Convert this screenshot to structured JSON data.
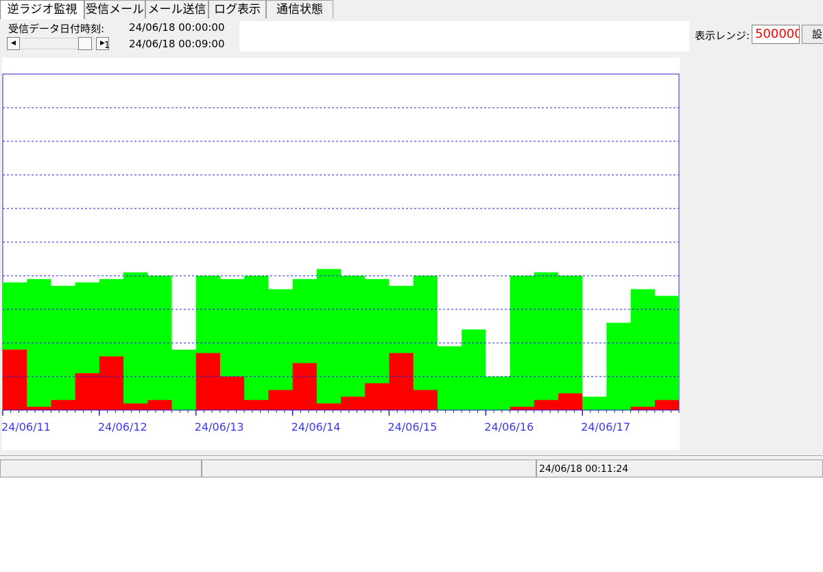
{
  "tabs": [
    {
      "label": "逆ラジオ監視",
      "active": true
    },
    {
      "label": "受信メール",
      "active": false
    },
    {
      "label": "メール送信",
      "active": false
    },
    {
      "label": "ログ表示",
      "active": false
    },
    {
      "label": "通信状態",
      "active": false
    }
  ],
  "info": {
    "received_label": "受信データ日付時刻:",
    "received_time_1": "24/06/18 00:00:00",
    "received_time_2": "24/06/18 00:09:00",
    "scroll_value": "1"
  },
  "range": {
    "label": "表示レンジ:",
    "value": "500000",
    "set_button": "設定"
  },
  "status": {
    "cell1": "",
    "cell2": "",
    "timestamp": "24/06/18 00:11:24"
  },
  "colors": {
    "series_total": "#00ff00",
    "series_sub": "#ff0000",
    "grid": "#2020c0",
    "axis_label": "#3a3af0",
    "range_value": "#ff0000"
  },
  "chart_data": {
    "type": "area",
    "x_ticks": [
      "24/06/11",
      "24/06/12",
      "24/06/13",
      "24/06/14",
      "24/06/15",
      "24/06/16",
      "24/06/17"
    ],
    "ylim": [
      0,
      500000
    ],
    "grid": true,
    "legend": "none",
    "series": [
      {
        "color": "green",
        "x": [
          "24/06/11 00:00",
          "24/06/11 06:00",
          "24/06/11 12:00",
          "24/06/11 18:00",
          "24/06/12 00:00",
          "24/06/12 06:00",
          "24/06/12 12:00",
          "24/06/12 18:00",
          "24/06/13 00:00",
          "24/06/13 06:00",
          "24/06/13 12:00",
          "24/06/13 18:00",
          "24/06/14 00:00",
          "24/06/14 06:00",
          "24/06/14 12:00",
          "24/06/14 18:00",
          "24/06/15 00:00",
          "24/06/15 06:00",
          "24/06/15 12:00",
          "24/06/15 18:00",
          "24/06/16 00:00",
          "24/06/16 06:00",
          "24/06/16 12:00",
          "24/06/16 18:00",
          "24/06/17 00:00",
          "24/06/17 06:00",
          "24/06/17 12:00",
          "24/06/17 18:00"
        ],
        "values": [
          190000,
          195000,
          185000,
          190000,
          195000,
          205000,
          200000,
          90000,
          200000,
          195000,
          200000,
          180000,
          195000,
          210000,
          200000,
          195000,
          185000,
          200000,
          95000,
          120000,
          50000,
          200000,
          205000,
          200000,
          20000,
          130000,
          180000,
          170000
        ]
      },
      {
        "color": "red",
        "x": [
          "24/06/11 00:00",
          "24/06/11 06:00",
          "24/06/11 12:00",
          "24/06/11 18:00",
          "24/06/12 00:00",
          "24/06/12 06:00",
          "24/06/12 12:00",
          "24/06/12 18:00",
          "24/06/13 00:00",
          "24/06/13 06:00",
          "24/06/13 12:00",
          "24/06/13 18:00",
          "24/06/14 00:00",
          "24/06/14 06:00",
          "24/06/14 12:00",
          "24/06/14 18:00",
          "24/06/15 00:00",
          "24/06/15 06:00",
          "24/06/15 12:00",
          "24/06/15 18:00",
          "24/06/16 00:00",
          "24/06/16 06:00",
          "24/06/16 12:00",
          "24/06/16 18:00",
          "24/06/17 00:00",
          "24/06/17 06:00",
          "24/06/17 12:00",
          "24/06/17 18:00"
        ],
        "values": [
          90000,
          5000,
          15000,
          55000,
          80000,
          10000,
          15000,
          0,
          85000,
          50000,
          15000,
          30000,
          70000,
          10000,
          20000,
          40000,
          85000,
          30000,
          0,
          0,
          0,
          5000,
          15000,
          25000,
          0,
          0,
          5000,
          15000
        ]
      }
    ]
  }
}
